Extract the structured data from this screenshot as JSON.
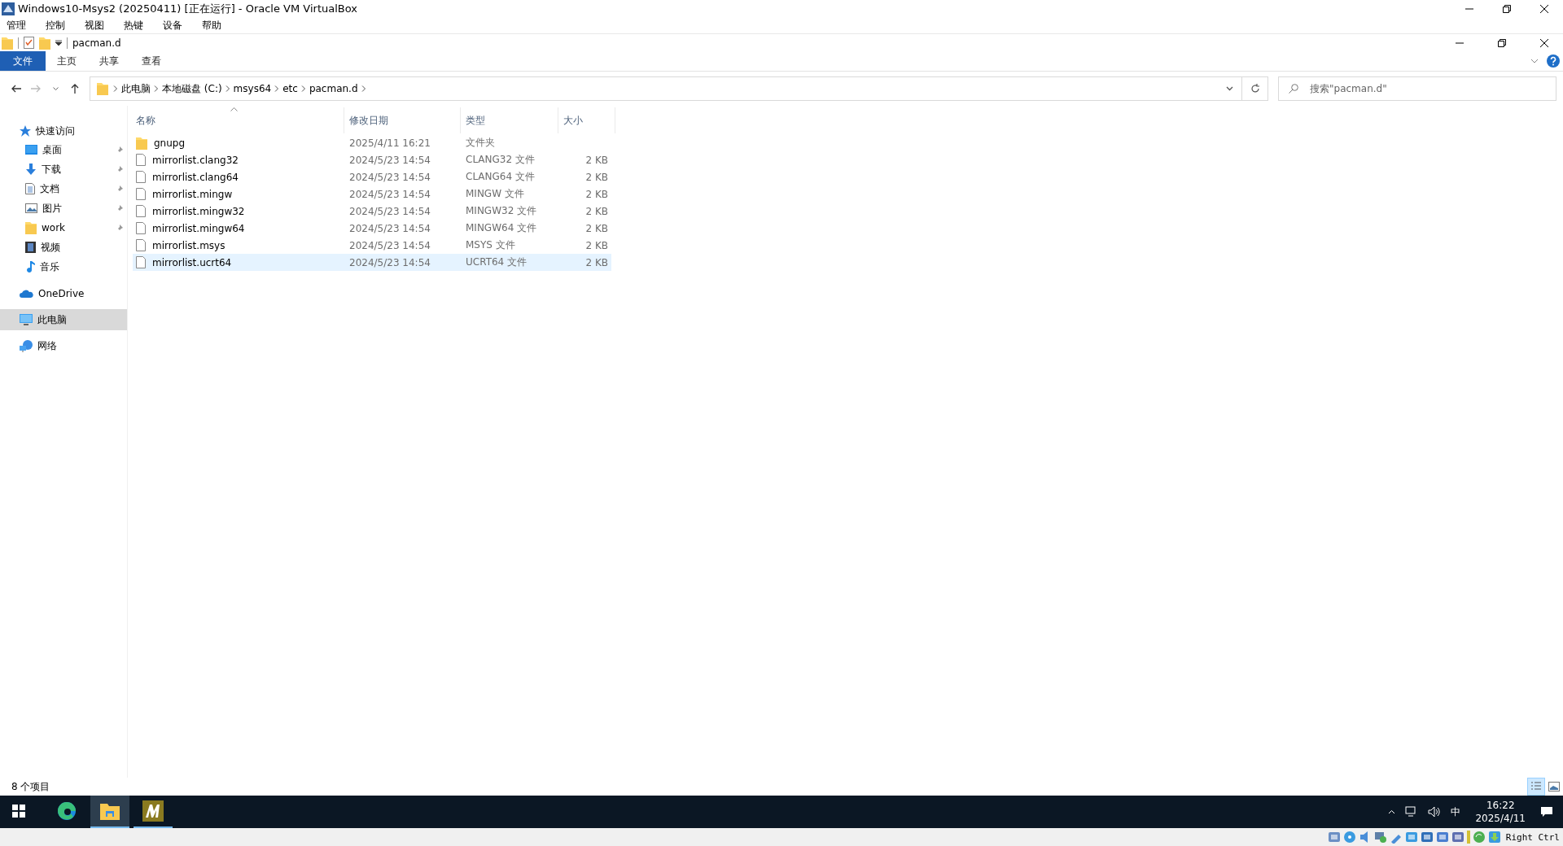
{
  "vbox": {
    "title": "Windows10-Msys2 (20250411) [正在运行] - Oracle VM VirtualBox",
    "menu": [
      "管理",
      "控制",
      "视图",
      "热键",
      "设备",
      "帮助"
    ],
    "host_key": "Right Ctrl"
  },
  "explorer": {
    "title": "pacman.d",
    "ribbon_tabs": [
      {
        "label": "文件",
        "selected": true
      },
      {
        "label": "主页",
        "selected": false
      },
      {
        "label": "共享",
        "selected": false
      },
      {
        "label": "查看",
        "selected": false
      }
    ],
    "breadcrumb": [
      "此电脑",
      "本地磁盘 (C:)",
      "msys64",
      "etc",
      "pacman.d"
    ],
    "search": {
      "placeholder": "搜索\"pacman.d\""
    },
    "navigation": [
      {
        "label": "快速访问",
        "kind": "quick",
        "selected": false,
        "children": [
          {
            "label": "桌面",
            "kind": "desktop",
            "pinned": true,
            "selected": false
          },
          {
            "label": "下载",
            "kind": "download",
            "pinned": true,
            "selected": false
          },
          {
            "label": "文档",
            "kind": "documents",
            "pinned": true,
            "selected": false
          },
          {
            "label": "图片",
            "kind": "pictures",
            "pinned": true,
            "selected": false
          },
          {
            "label": "work",
            "kind": "folder",
            "pinned": true,
            "selected": false
          },
          {
            "label": "视频",
            "kind": "videos",
            "pinned": false,
            "selected": false
          },
          {
            "label": "音乐",
            "kind": "music",
            "pinned": false,
            "selected": false
          }
        ]
      },
      {
        "label": "OneDrive",
        "kind": "onedrive",
        "selected": false
      },
      {
        "label": "此电脑",
        "kind": "pc",
        "selected": true
      },
      {
        "label": "网络",
        "kind": "network",
        "selected": false
      }
    ],
    "columns": [
      "名称",
      "修改日期",
      "类型",
      "大小"
    ],
    "rows": [
      {
        "name": "gnupg",
        "kind": "folder",
        "date": "2025/4/11 16:21",
        "type": "文件夹",
        "selected": false
      },
      {
        "name": "mirrorlist.clang32",
        "kind": "file",
        "date": "2024/5/23 14:54",
        "type": "CLANG32 文件",
        "size": "2 KB",
        "selected": false
      },
      {
        "name": "mirrorlist.clang64",
        "kind": "file",
        "date": "2024/5/23 14:54",
        "type": "CLANG64 文件",
        "size": "2 KB",
        "selected": false
      },
      {
        "name": "mirrorlist.mingw",
        "kind": "file",
        "date": "2024/5/23 14:54",
        "type": "MINGW 文件",
        "size": "2 KB",
        "selected": false
      },
      {
        "name": "mirrorlist.mingw32",
        "kind": "file",
        "date": "2024/5/23 14:54",
        "type": "MINGW32 文件",
        "size": "2 KB",
        "selected": false
      },
      {
        "name": "mirrorlist.mingw64",
        "kind": "file",
        "date": "2024/5/23 14:54",
        "type": "MINGW64 文件",
        "size": "2 KB",
        "selected": false
      },
      {
        "name": "mirrorlist.msys",
        "kind": "file",
        "date": "2024/5/23 14:54",
        "type": "MSYS 文件",
        "size": "2 KB",
        "selected": false
      },
      {
        "name": "mirrorlist.ucrt64",
        "kind": "file",
        "date": "2024/5/23 14:54",
        "type": "UCRT64 文件",
        "size": "2 KB",
        "selected": true
      }
    ],
    "status": "8 个项目",
    "views": [
      {
        "kind": "details",
        "selected": true
      },
      {
        "kind": "preview",
        "selected": false
      }
    ]
  },
  "taskbar": {
    "apps": [
      {
        "kind": "edge",
        "selected": false,
        "running": false
      },
      {
        "kind": "explorer",
        "selected": true,
        "running": true
      },
      {
        "kind": "m-app",
        "selected": false,
        "running": true
      }
    ],
    "ime": "中",
    "time": "16:22",
    "date": "2025/4/11"
  }
}
